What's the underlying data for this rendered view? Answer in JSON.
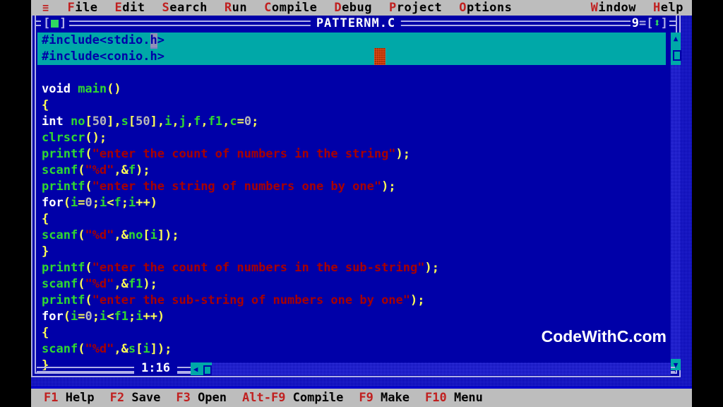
{
  "menubar": {
    "hamburger_icon": "≡",
    "items": [
      {
        "label": "File",
        "hot": "F"
      },
      {
        "label": "Edit",
        "hot": "E"
      },
      {
        "label": "Search",
        "hot": "S"
      },
      {
        "label": "Run",
        "hot": "R"
      },
      {
        "label": "Compile",
        "hot": "C"
      },
      {
        "label": "Debug",
        "hot": "D"
      },
      {
        "label": "Project",
        "hot": "P"
      },
      {
        "label": "Options",
        "hot": "O"
      }
    ],
    "right_items": [
      {
        "label": "Window",
        "hot": "W"
      },
      {
        "label": "Help",
        "hot": "H"
      }
    ]
  },
  "window": {
    "title": "PATTERNM.C",
    "number": "9",
    "close_left": "[",
    "close_right": "]",
    "zoom_left": "=[",
    "zoom_right": "]",
    "zoom_icon": "⬍",
    "position": "1:16"
  },
  "code": {
    "lines": [
      {
        "selected": true,
        "tokens": [
          {
            "t": "pre",
            "v": "#include<stdio."
          },
          {
            "t": "caret",
            "v": "h"
          },
          {
            "t": "pre",
            "v": ">"
          }
        ]
      },
      {
        "selected": true,
        "tokens": [
          {
            "t": "pre",
            "v": "#include<conio.h>"
          }
        ]
      },
      {
        "selected": false,
        "tokens": []
      },
      {
        "selected": false,
        "tokens": [
          {
            "t": "kw",
            "v": "void "
          },
          {
            "t": "id",
            "v": "main"
          },
          {
            "t": "punct",
            "v": "()"
          }
        ]
      },
      {
        "selected": false,
        "tokens": [
          {
            "t": "punct",
            "v": "{"
          }
        ]
      },
      {
        "selected": false,
        "tokens": [
          {
            "t": "kw",
            "v": "int "
          },
          {
            "t": "id",
            "v": "no"
          },
          {
            "t": "punct",
            "v": "["
          },
          {
            "t": "num",
            "v": "50"
          },
          {
            "t": "punct",
            "v": "],"
          },
          {
            "t": "id",
            "v": "s"
          },
          {
            "t": "punct",
            "v": "["
          },
          {
            "t": "num",
            "v": "50"
          },
          {
            "t": "punct",
            "v": "],"
          },
          {
            "t": "id",
            "v": "i"
          },
          {
            "t": "punct",
            "v": ","
          },
          {
            "t": "id",
            "v": "j"
          },
          {
            "t": "punct",
            "v": ","
          },
          {
            "t": "id",
            "v": "f"
          },
          {
            "t": "punct",
            "v": ","
          },
          {
            "t": "id",
            "v": "f1"
          },
          {
            "t": "punct",
            "v": ","
          },
          {
            "t": "id",
            "v": "c"
          },
          {
            "t": "punct",
            "v": "="
          },
          {
            "t": "num",
            "v": "0"
          },
          {
            "t": "punct",
            "v": ";"
          }
        ]
      },
      {
        "selected": false,
        "tokens": [
          {
            "t": "id",
            "v": "clrscr"
          },
          {
            "t": "punct",
            "v": "();"
          }
        ]
      },
      {
        "selected": false,
        "tokens": [
          {
            "t": "id",
            "v": "printf"
          },
          {
            "t": "punct",
            "v": "("
          },
          {
            "t": "str",
            "v": "\"enter the count of numbers in the string\""
          },
          {
            "t": "punct",
            "v": ");"
          }
        ]
      },
      {
        "selected": false,
        "tokens": [
          {
            "t": "id",
            "v": "scanf"
          },
          {
            "t": "punct",
            "v": "("
          },
          {
            "t": "str",
            "v": "\"%d\""
          },
          {
            "t": "punct",
            "v": ",&"
          },
          {
            "t": "id",
            "v": "f"
          },
          {
            "t": "punct",
            "v": ");"
          }
        ]
      },
      {
        "selected": false,
        "tokens": [
          {
            "t": "id",
            "v": "printf"
          },
          {
            "t": "punct",
            "v": "("
          },
          {
            "t": "str",
            "v": "\"enter the string of numbers one by one\""
          },
          {
            "t": "punct",
            "v": ");"
          }
        ]
      },
      {
        "selected": false,
        "tokens": [
          {
            "t": "kw",
            "v": "for"
          },
          {
            "t": "punct",
            "v": "("
          },
          {
            "t": "id",
            "v": "i"
          },
          {
            "t": "punct",
            "v": "="
          },
          {
            "t": "num",
            "v": "0"
          },
          {
            "t": "punct",
            "v": ";"
          },
          {
            "t": "id",
            "v": "i"
          },
          {
            "t": "punct",
            "v": "<"
          },
          {
            "t": "id",
            "v": "f"
          },
          {
            "t": "punct",
            "v": ";"
          },
          {
            "t": "id",
            "v": "i"
          },
          {
            "t": "punct",
            "v": "++)"
          }
        ]
      },
      {
        "selected": false,
        "tokens": [
          {
            "t": "punct",
            "v": "{"
          }
        ]
      },
      {
        "selected": false,
        "tokens": [
          {
            "t": "id",
            "v": "scanf"
          },
          {
            "t": "punct",
            "v": "("
          },
          {
            "t": "str",
            "v": "\"%d\""
          },
          {
            "t": "punct",
            "v": ",&"
          },
          {
            "t": "id",
            "v": "no"
          },
          {
            "t": "punct",
            "v": "["
          },
          {
            "t": "id",
            "v": "i"
          },
          {
            "t": "punct",
            "v": "]);"
          }
        ]
      },
      {
        "selected": false,
        "tokens": [
          {
            "t": "punct",
            "v": "}"
          }
        ]
      },
      {
        "selected": false,
        "tokens": [
          {
            "t": "id",
            "v": "printf"
          },
          {
            "t": "punct",
            "v": "("
          },
          {
            "t": "str",
            "v": "\"enter the count of numbers in the sub-string\""
          },
          {
            "t": "punct",
            "v": ");"
          }
        ]
      },
      {
        "selected": false,
        "tokens": [
          {
            "t": "id",
            "v": "scanf"
          },
          {
            "t": "punct",
            "v": "("
          },
          {
            "t": "str",
            "v": "\"%d\""
          },
          {
            "t": "punct",
            "v": ",&"
          },
          {
            "t": "id",
            "v": "f1"
          },
          {
            "t": "punct",
            "v": ");"
          }
        ]
      },
      {
        "selected": false,
        "tokens": [
          {
            "t": "id",
            "v": "printf"
          },
          {
            "t": "punct",
            "v": "("
          },
          {
            "t": "str",
            "v": "\"enter the sub-string of numbers one by one\""
          },
          {
            "t": "punct",
            "v": ");"
          }
        ]
      },
      {
        "selected": false,
        "tokens": [
          {
            "t": "kw",
            "v": "for"
          },
          {
            "t": "punct",
            "v": "("
          },
          {
            "t": "id",
            "v": "i"
          },
          {
            "t": "punct",
            "v": "="
          },
          {
            "t": "num",
            "v": "0"
          },
          {
            "t": "punct",
            "v": ";"
          },
          {
            "t": "id",
            "v": "i"
          },
          {
            "t": "punct",
            "v": "<"
          },
          {
            "t": "id",
            "v": "f1"
          },
          {
            "t": "punct",
            "v": ";"
          },
          {
            "t": "id",
            "v": "i"
          },
          {
            "t": "punct",
            "v": "++)"
          }
        ]
      },
      {
        "selected": false,
        "tokens": [
          {
            "t": "punct",
            "v": "{"
          }
        ]
      },
      {
        "selected": false,
        "tokens": [
          {
            "t": "id",
            "v": "scanf"
          },
          {
            "t": "punct",
            "v": "("
          },
          {
            "t": "str",
            "v": "\"%d\""
          },
          {
            "t": "punct",
            "v": ",&"
          },
          {
            "t": "id",
            "v": "s"
          },
          {
            "t": "punct",
            "v": "["
          },
          {
            "t": "id",
            "v": "i"
          },
          {
            "t": "punct",
            "v": "]);"
          }
        ]
      },
      {
        "selected": false,
        "tokens": [
          {
            "t": "punct",
            "v": "}"
          }
        ]
      }
    ]
  },
  "scrollbars": {
    "v_up_icon": "▲",
    "v_down_icon": "▼",
    "h_left_icon": "◀"
  },
  "watermark": {
    "text": "CodeWithC.com"
  },
  "fkeys": [
    {
      "key": "F1",
      "desc": "Help"
    },
    {
      "key": "F2",
      "desc": "Save"
    },
    {
      "key": "F3",
      "desc": "Open"
    },
    {
      "key": "Alt-F9",
      "desc": "Compile"
    },
    {
      "key": "F9",
      "desc": "Make"
    },
    {
      "key": "F10",
      "desc": "Menu"
    }
  ],
  "colors": {
    "desktop_blue": "#0000a8",
    "menu_gray": "#bdbdbd",
    "hotkey_red": "#c02020",
    "selection_cyan": "#00a8a8",
    "keyword_white": "#ffffff",
    "identifier_green": "#30d830",
    "punct_yellow": "#ffff54",
    "string_red": "#a80000",
    "frame_lavender": "#b0b0e8",
    "accent_green": "#30d860"
  }
}
